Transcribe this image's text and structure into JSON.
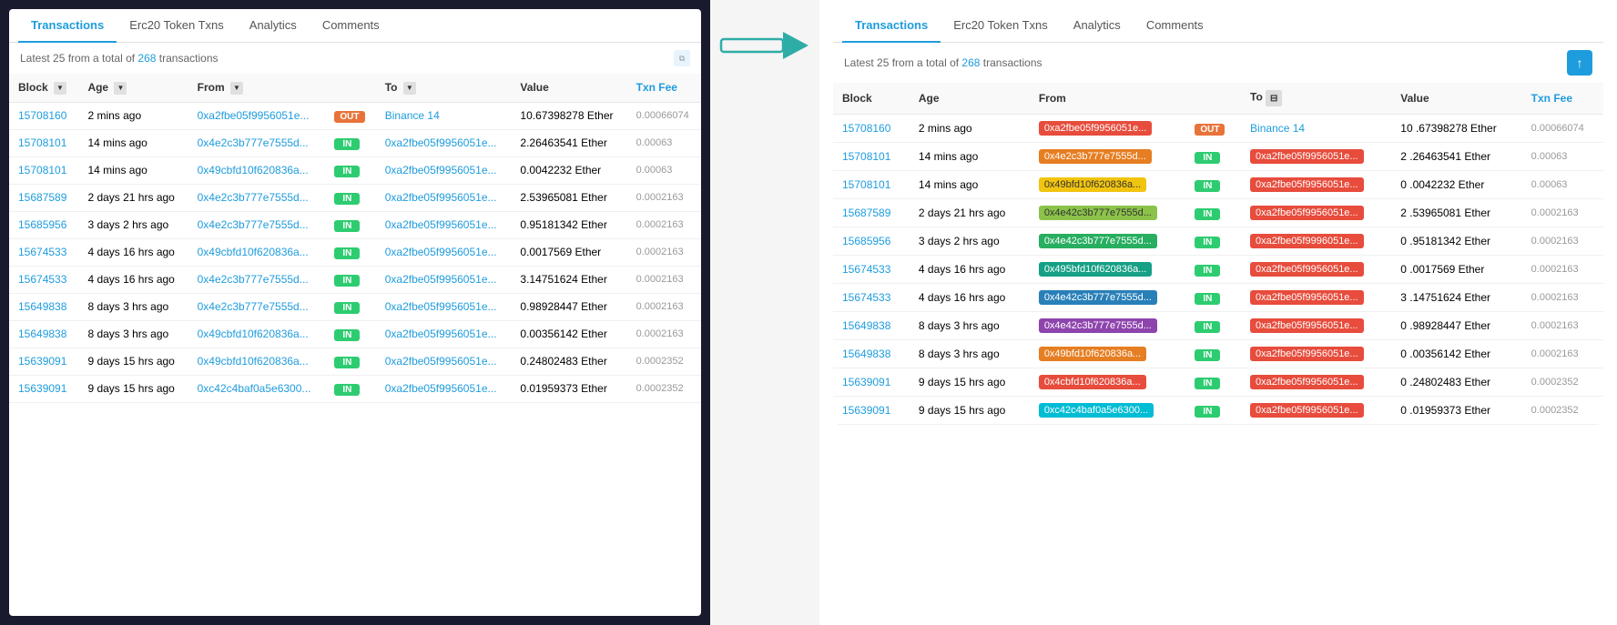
{
  "left": {
    "tabs": [
      {
        "label": "Transactions",
        "active": true
      },
      {
        "label": "Erc20 Token Txns",
        "active": false
      },
      {
        "label": "Analytics",
        "active": false
      },
      {
        "label": "Comments",
        "active": false
      }
    ],
    "summary": {
      "prefix": "Latest 25 from a total of",
      "count": "268",
      "suffix": "transactions"
    },
    "columns": [
      "Block",
      "Age",
      "From",
      "To",
      "Value",
      "Txn Fee"
    ],
    "rows": [
      {
        "block": "15708160",
        "age": "2 mins ago",
        "from": "0xa2fbe05f9956051e...",
        "badge": "OUT",
        "to": "Binance 14",
        "value": "10.67398278 Ether",
        "fee": "0.00066074"
      },
      {
        "block": "15708101",
        "age": "14 mins ago",
        "from": "0x4e2c3b777e7555d...",
        "badge": "IN",
        "to": "0xa2fbe05f9956051e...",
        "value": "2.26463541 Ether",
        "fee": "0.00063"
      },
      {
        "block": "15708101",
        "age": "14 mins ago",
        "from": "0x49cbfd10f620836a...",
        "badge": "IN",
        "to": "0xa2fbe05f9956051e...",
        "value": "0.0042232 Ether",
        "fee": "0.00063"
      },
      {
        "block": "15687589",
        "age": "2 days 21 hrs ago",
        "from": "0x4e2c3b777e7555d...",
        "badge": "IN",
        "to": "0xa2fbe05f9956051e...",
        "value": "2.53965081 Ether",
        "fee": "0.0002163"
      },
      {
        "block": "15685956",
        "age": "3 days 2 hrs ago",
        "from": "0x4e2c3b777e7555d...",
        "badge": "IN",
        "to": "0xa2fbe05f9956051e...",
        "value": "0.95181342 Ether",
        "fee": "0.0002163"
      },
      {
        "block": "15674533",
        "age": "4 days 16 hrs ago",
        "from": "0x49cbfd10f620836a...",
        "badge": "IN",
        "to": "0xa2fbe05f9956051e...",
        "value": "0.0017569 Ether",
        "fee": "0.0002163"
      },
      {
        "block": "15674533",
        "age": "4 days 16 hrs ago",
        "from": "0x4e2c3b777e7555d...",
        "badge": "IN",
        "to": "0xa2fbe05f9956051e...",
        "value": "3.14751624 Ether",
        "fee": "0.0002163"
      },
      {
        "block": "15649838",
        "age": "8 days 3 hrs ago",
        "from": "0x4e2c3b777e7555d...",
        "badge": "IN",
        "to": "0xa2fbe05f9956051e...",
        "value": "0.98928447 Ether",
        "fee": "0.0002163"
      },
      {
        "block": "15649838",
        "age": "8 days 3 hrs ago",
        "from": "0x49cbfd10f620836a...",
        "badge": "IN",
        "to": "0xa2fbe05f9956051e...",
        "value": "0.00356142 Ether",
        "fee": "0.0002163"
      },
      {
        "block": "15639091",
        "age": "9 days 15 hrs ago",
        "from": "0x49cbfd10f620836a...",
        "badge": "IN",
        "to": "0xa2fbe05f9956051e...",
        "value": "0.24802483 Ether",
        "fee": "0.0002352"
      },
      {
        "block": "15639091",
        "age": "9 days 15 hrs ago",
        "from": "0xc42c4baf0a5e6300...",
        "badge": "IN",
        "to": "0xa2fbe05f9956051e...",
        "value": "0.01959373 Ether",
        "fee": "0.0002352"
      }
    ]
  },
  "right": {
    "tabs": [
      {
        "label": "Transactions",
        "active": true
      },
      {
        "label": "Erc20 Token Txns",
        "active": false
      },
      {
        "label": "Analytics",
        "active": false
      },
      {
        "label": "Comments",
        "active": false
      }
    ],
    "summary": {
      "prefix": "Latest 25 from a total of",
      "count": "268",
      "suffix": "transactions"
    },
    "columns": [
      "Block",
      "Age",
      "From",
      "",
      "To",
      "Value",
      "Txn Fee"
    ],
    "rows": [
      {
        "block": "15708160",
        "age": "2 mins ago",
        "from": "0xa2fbe05f9956051e...",
        "from_color": "pill-red",
        "badge": "OUT",
        "to": "Binance 14",
        "to_color": "",
        "value": "10 .67398278 Ether",
        "fee": "0.00066074"
      },
      {
        "block": "15708101",
        "age": "14 mins ago",
        "from": "0x4e2c3b777e7555d...",
        "from_color": "pill-orange",
        "badge": "IN",
        "to": "0xa2fbe05f9956051e...",
        "to_color": "pill-red",
        "value": "2 .26463541 Ether",
        "fee": "0.00063"
      },
      {
        "block": "15708101",
        "age": "14 mins ago",
        "from": "0x49bfd10f620836a...",
        "from_color": "pill-yellow",
        "badge": "IN",
        "to": "0xa2fbe05f9956051e...",
        "to_color": "pill-red",
        "value": "0 .0042232 Ether",
        "fee": "0.00063"
      },
      {
        "block": "15687589",
        "age": "2 days 21 hrs ago",
        "from": "0x4e42c3b777e7555d...",
        "from_color": "pill-lime",
        "badge": "IN",
        "to": "0xa2fbe05f9956051e...",
        "to_color": "pill-red",
        "value": "2 .53965081 Ether",
        "fee": "0.0002163"
      },
      {
        "block": "15685956",
        "age": "3 days 2 hrs ago",
        "from": "0x4e42c3b777e7555d...",
        "from_color": "pill-green",
        "badge": "IN",
        "to": "0xa2fbe05f9996051e...",
        "to_color": "pill-red",
        "value": "0 .95181342 Ether",
        "fee": "0.0002163"
      },
      {
        "block": "15674533",
        "age": "4 days 16 hrs ago",
        "from": "0x495bfd10f620836a...",
        "from_color": "pill-teal",
        "badge": "IN",
        "to": "0xa2fbe05f9956051e...",
        "to_color": "pill-red",
        "value": "0 .0017569 Ether",
        "fee": "0.0002163"
      },
      {
        "block": "15674533",
        "age": "4 days 16 hrs ago",
        "from": "0x4e42c3b777e7555d...",
        "from_color": "pill-blue",
        "badge": "IN",
        "to": "0xa2fbe05f9956051e...",
        "to_color": "pill-red",
        "value": "3 .14751624 Ether",
        "fee": "0.0002163"
      },
      {
        "block": "15649838",
        "age": "8 days 3 hrs ago",
        "from": "0x4e42c3b777e7555d...",
        "from_color": "pill-purple",
        "badge": "IN",
        "to": "0xa2fbe05f9956051e...",
        "to_color": "pill-red",
        "value": "0 .98928447 Ether",
        "fee": "0.0002163"
      },
      {
        "block": "15649838",
        "age": "8 days 3 hrs ago",
        "from": "0x49bfd10f620836a...",
        "from_color": "pill-orange",
        "badge": "IN",
        "to": "0xa2fbe05f9956051e...",
        "to_color": "pill-red",
        "value": "0 .00356142 Ether",
        "fee": "0.0002163"
      },
      {
        "block": "15639091",
        "age": "9 days 15 hrs ago",
        "from": "0x4cbfd10f620836a...",
        "from_color": "pill-red",
        "badge": "IN",
        "to": "0xa2fbe05f9956051e...",
        "to_color": "pill-red",
        "value": "0 .24802483 Ether",
        "fee": "0.0002352"
      },
      {
        "block": "15639091",
        "age": "9 days 15 hrs ago",
        "from": "0xc42c4baf0a5e6300...",
        "from_color": "pill-cyan",
        "badge": "IN",
        "to": "0xa2fbe05f9956051e...",
        "to_color": "pill-red",
        "value": "0 .01959373 Ether",
        "fee": "0.0002352"
      }
    ]
  },
  "arrow": "→"
}
